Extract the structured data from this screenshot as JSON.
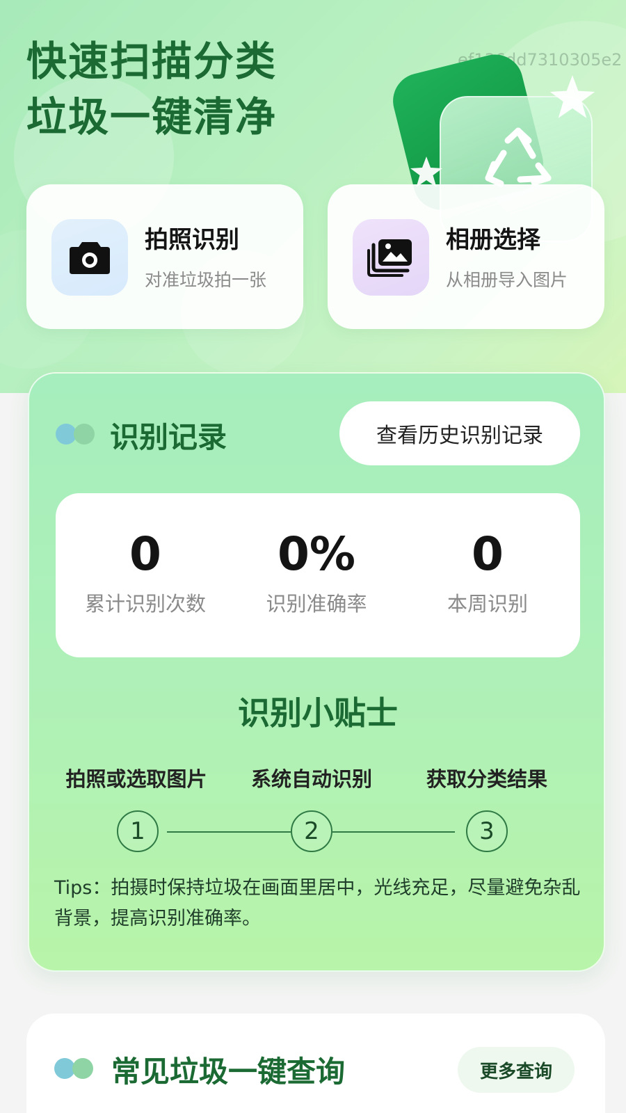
{
  "hero": {
    "title_line1": "快速扫描分类",
    "title_line2": "垃圾一键清净",
    "watermark": "ef136dd7310305e2"
  },
  "actions": [
    {
      "title": "拍照识别",
      "subtitle": "对准垃圾拍一张",
      "icon": "camera-icon"
    },
    {
      "title": "相册选择",
      "subtitle": "从相册导入图片",
      "icon": "photo-album-icon"
    }
  ],
  "record": {
    "title": "识别记录",
    "history_button": "查看历史识别记录",
    "stats": [
      {
        "value": "0",
        "label": "累计识别次数"
      },
      {
        "value": "0%",
        "label": "识别准确率"
      },
      {
        "value": "0",
        "label": "本周识别"
      }
    ],
    "tips_title": "识别小贴士",
    "steps": [
      {
        "number": "1",
        "label": "拍照或选取图片"
      },
      {
        "number": "2",
        "label": "系统自动识别"
      },
      {
        "number": "3",
        "label": "获取分类结果"
      }
    ],
    "tips_text": "Tips：拍摄时保持垃圾在画面里居中，光线充足，尽量避免杂乱背景，提高识别准确率。"
  },
  "common": {
    "title": "常见垃圾一键查询",
    "more_button": "更多查询"
  },
  "colors": {
    "brand_green": "#1b6a33",
    "accent_green": "#0f8f3f",
    "dot_blue": "#7fc9d9",
    "dot_green": "#8fd4a4"
  }
}
